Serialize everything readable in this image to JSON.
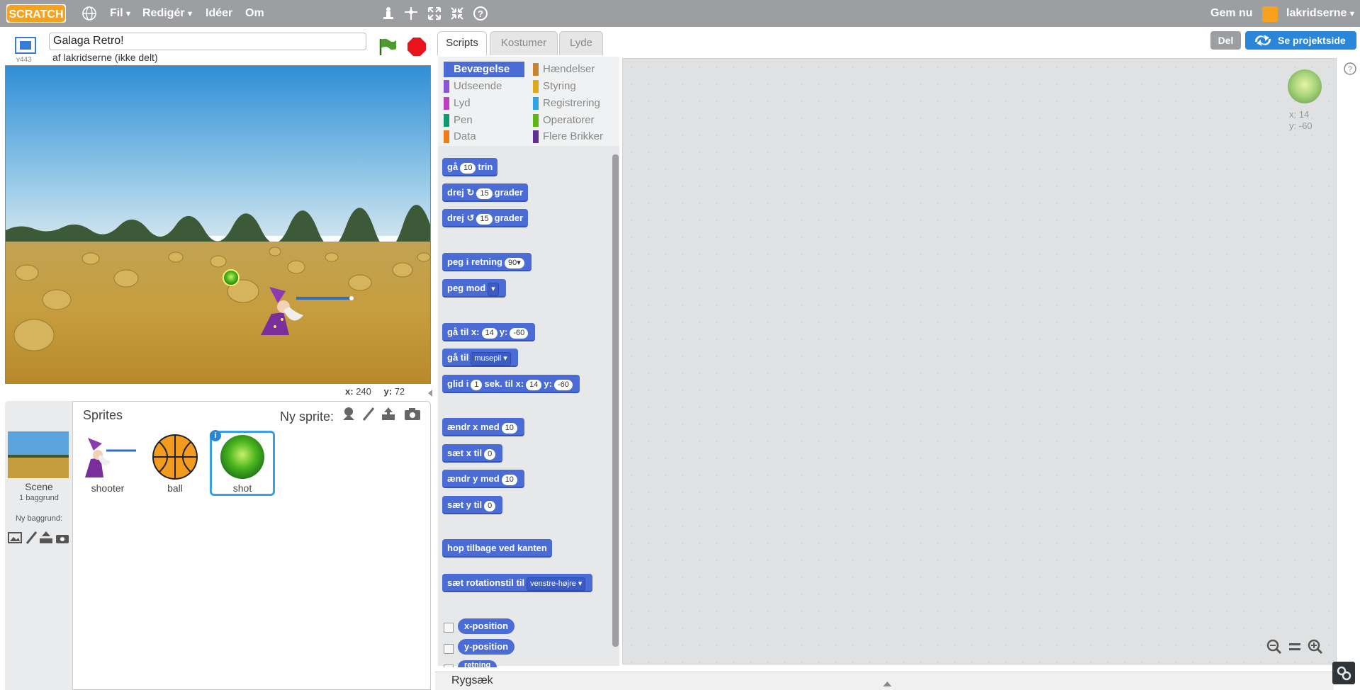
{
  "topbar": {
    "logo_text": "SCRATCH",
    "menu_file": "Fil",
    "menu_edit": "Redigér",
    "menu_ideas": "Idéer",
    "menu_about": "Om",
    "save_now": "Gem nu",
    "username": "lakridserne",
    "icons": [
      "globe-icon",
      "duplicate-icon",
      "cut-icon",
      "grow-icon",
      "shrink-icon",
      "help-icon"
    ]
  },
  "stage_header": {
    "project_title": "Galaga Retro!",
    "byline": "af lakridserne (ikke delt)",
    "version": "v443"
  },
  "stage": {
    "mouse_x_label": "x:",
    "mouse_x": "240",
    "mouse_y_label": "y:",
    "mouse_y": "72"
  },
  "sprites_pane": {
    "title": "Sprites",
    "new_sprite_label": "Ny sprite:",
    "scene_label": "Scene",
    "scene_backdrops": "1 baggrund",
    "new_backdrop_label": "Ny baggrund:",
    "sprites": [
      {
        "name": "shooter"
      },
      {
        "name": "ball"
      },
      {
        "name": "shot",
        "selected": true
      }
    ]
  },
  "tabs": [
    "Scripts",
    "Kostumer",
    "Lyde"
  ],
  "share_button": "Del",
  "project_page_button": "Se projektside",
  "categories": [
    {
      "label": "Bevægelse",
      "color": "#4a6cd4",
      "active": true
    },
    {
      "label": "Udseende",
      "color": "#8a55d7"
    },
    {
      "label": "Lyd",
      "color": "#bb42c3"
    },
    {
      "label": "Pen",
      "color": "#0e9a6c"
    },
    {
      "label": "Data",
      "color": "#ee7d16"
    },
    {
      "label": "Hændelser",
      "color": "#c88330"
    },
    {
      "label": "Styring",
      "color": "#e1a91a"
    },
    {
      "label": "Registrering",
      "color": "#2ca5e2"
    },
    {
      "label": "Operatorer",
      "color": "#5cb712"
    },
    {
      "label": "Flere Brikker",
      "color": "#632d99"
    }
  ],
  "blocks": {
    "move": {
      "a": "gå",
      "v": "10",
      "b": "trin"
    },
    "turn_right": {
      "a": "drej",
      "v": "15",
      "b": "grader"
    },
    "turn_left": {
      "a": "drej",
      "v": "15",
      "b": "grader"
    },
    "point_dir": {
      "a": "peg i retning",
      "v": "90"
    },
    "point_towards": {
      "a": "peg mod"
    },
    "goto_xy": {
      "a": "gå til x:",
      "x": "14",
      "b": "y:",
      "y": "-60"
    },
    "goto": {
      "a": "gå til",
      "v": "musepil"
    },
    "glide": {
      "a": "glid i",
      "s": "1",
      "b": "sek. til x:",
      "x": "14",
      "c": "y:",
      "y": "-60"
    },
    "change_x": {
      "a": "ændr x med",
      "v": "10"
    },
    "set_x": {
      "a": "sæt x til",
      "v": "0"
    },
    "change_y": {
      "a": "ændr y med",
      "v": "10"
    },
    "set_y": {
      "a": "sæt y til",
      "v": "0"
    },
    "bounce": {
      "a": "hop tilbage ved kanten"
    },
    "rotation": {
      "a": "sæt rotationstil til",
      "v": "venstre-højre"
    },
    "rep_x": "x-position",
    "rep_y": "y-position",
    "rep_dir": "retning"
  },
  "script_area": {
    "sprite_x_label": "x:",
    "sprite_x": "14",
    "sprite_y_label": "y:",
    "sprite_y": "-60"
  },
  "backpack_label": "Rygsæk"
}
